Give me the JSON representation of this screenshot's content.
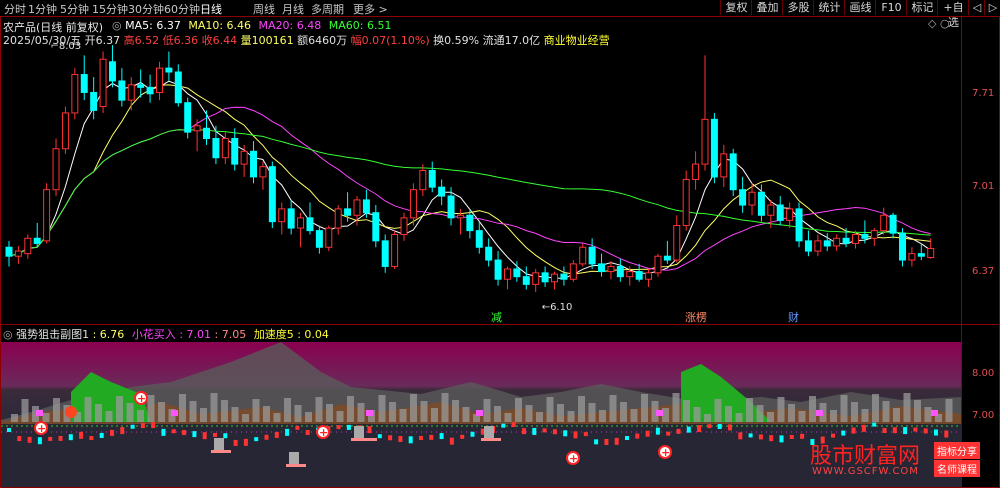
{
  "toolbar": {
    "timeframes": [
      "分时",
      "1分钟",
      "5分钟",
      "15分钟",
      "30分钟",
      "60分钟",
      "日线",
      "周线",
      "月线",
      "多周期",
      "更多 >"
    ],
    "active_timeframe": "日线",
    "right_buttons": [
      "复权",
      "叠加",
      "多股",
      "统计",
      "画线",
      "F10",
      "标记",
      "+自选",
      "◁",
      "▷"
    ]
  },
  "stock": {
    "title": "农产品(日线 前复权)",
    "date": "2025/05/30/五",
    "open_label": "开",
    "open": "6.37",
    "high_label": "高",
    "high": "6.52",
    "low_label": "低",
    "low": "6.36",
    "close_label": "收",
    "close": "6.44",
    "vol_label": "量",
    "volume": "100161",
    "amount_label": "额",
    "amount": "6460万",
    "chg_label": "幅",
    "change": "0.07(1.10%)",
    "turnover": "换0.59%",
    "float_cap": "流通17.0亿",
    "industry": "商业物业经营"
  },
  "ma_legend": [
    {
      "label": "MA5: 6.37",
      "color": "#ffffff"
    },
    {
      "label": "MA10: 6.46",
      "color": "#ffff66"
    },
    {
      "label": "MA20: 6.48",
      "color": "#ff44ff"
    },
    {
      "label": "MA60: 6.51",
      "color": "#33ff33"
    }
  ],
  "sub_indicator": {
    "name": "强势狙击副图1",
    "v1": ": 6.76",
    "v2_label": "小花买入",
    "v2": ": 7.01",
    "v3": ": 7.05",
    "v4_label": "加速度5",
    "v4": ": 0.04"
  },
  "watermark": {
    "brand": "股市财富网",
    "url": "WWW.GSCFW.COM",
    "tag1": "指标分享",
    "tag2": "名师课程"
  },
  "colors": {
    "up": "#ff3232",
    "down": "#00ffff",
    "ma5": "#ffffff",
    "ma10": "#ffff66",
    "ma20": "#ff44ff",
    "ma60": "#33ff33",
    "frame": "#8b0000"
  },
  "chart_data": {
    "type": "candlestick",
    "price_axis_labels": [
      "7.71",
      "7.01",
      "6.37"
    ],
    "sub_axis_labels": [
      "8.00",
      "7.00"
    ],
    "annotations": {
      "high_mark": "8.03",
      "low_mark": "6.10",
      "events": [
        "减",
        "涨楞",
        "财"
      ]
    },
    "ylim": [
      5.85,
      8.25
    ],
    "candles": [
      [
        6.45,
        6.5,
        6.3,
        6.38
      ],
      [
        6.38,
        6.46,
        6.32,
        6.42
      ],
      [
        6.4,
        6.55,
        6.36,
        6.52
      ],
      [
        6.52,
        6.64,
        6.45,
        6.48
      ],
      [
        6.5,
        6.95,
        6.48,
        6.9
      ],
      [
        6.9,
        7.3,
        6.85,
        7.22
      ],
      [
        7.22,
        7.55,
        7.18,
        7.5
      ],
      [
        7.5,
        7.85,
        7.45,
        7.8
      ],
      [
        7.8,
        7.95,
        7.6,
        7.66
      ],
      [
        7.66,
        7.78,
        7.45,
        7.52
      ],
      [
        7.55,
        7.98,
        7.5,
        7.92
      ],
      [
        7.9,
        8.03,
        7.7,
        7.75
      ],
      [
        7.75,
        7.85,
        7.55,
        7.6
      ],
      [
        7.6,
        7.78,
        7.52,
        7.72
      ],
      [
        7.72,
        7.84,
        7.62,
        7.7
      ],
      [
        7.7,
        7.8,
        7.58,
        7.65
      ],
      [
        7.66,
        7.9,
        7.6,
        7.85
      ],
      [
        7.85,
        7.98,
        7.75,
        7.82
      ],
      [
        7.82,
        7.88,
        7.55,
        7.58
      ],
      [
        7.58,
        7.62,
        7.3,
        7.35
      ],
      [
        7.36,
        7.45,
        7.2,
        7.4
      ],
      [
        7.38,
        7.52,
        7.25,
        7.3
      ],
      [
        7.3,
        7.4,
        7.1,
        7.15
      ],
      [
        7.15,
        7.35,
        7.1,
        7.3
      ],
      [
        7.3,
        7.38,
        7.05,
        7.1
      ],
      [
        7.1,
        7.25,
        7.0,
        7.2
      ],
      [
        7.2,
        7.28,
        6.95,
        7.0
      ],
      [
        7.0,
        7.12,
        6.9,
        7.08
      ],
      [
        7.08,
        7.12,
        6.6,
        6.65
      ],
      [
        6.65,
        6.8,
        6.55,
        6.75
      ],
      [
        6.75,
        6.82,
        6.55,
        6.6
      ],
      [
        6.6,
        6.72,
        6.45,
        6.68
      ],
      [
        6.68,
        6.8,
        6.55,
        6.58
      ],
      [
        6.58,
        6.62,
        6.4,
        6.45
      ],
      [
        6.45,
        6.62,
        6.42,
        6.6
      ],
      [
        6.6,
        6.78,
        6.55,
        6.75
      ],
      [
        6.75,
        6.88,
        6.65,
        6.7
      ],
      [
        6.7,
        6.85,
        6.62,
        6.82
      ],
      [
        6.82,
        6.9,
        6.68,
        6.72
      ],
      [
        6.72,
        6.78,
        6.45,
        6.5
      ],
      [
        6.5,
        6.55,
        6.25,
        6.3
      ],
      [
        6.3,
        6.58,
        6.28,
        6.55
      ],
      [
        6.55,
        6.72,
        6.5,
        6.68
      ],
      [
        6.68,
        6.95,
        6.62,
        6.9
      ],
      [
        6.9,
        7.1,
        6.85,
        7.05
      ],
      [
        7.05,
        7.12,
        6.88,
        6.92
      ],
      [
        6.92,
        6.98,
        6.78,
        6.85
      ],
      [
        6.85,
        6.92,
        6.62,
        6.68
      ],
      [
        6.68,
        6.75,
        6.55,
        6.7
      ],
      [
        6.7,
        6.74,
        6.52,
        6.58
      ],
      [
        6.58,
        6.65,
        6.4,
        6.45
      ],
      [
        6.45,
        6.52,
        6.3,
        6.35
      ],
      [
        6.35,
        6.42,
        6.15,
        6.2
      ],
      [
        6.2,
        6.3,
        6.12,
        6.28
      ],
      [
        6.28,
        6.34,
        6.18,
        6.22
      ],
      [
        6.22,
        6.3,
        6.12,
        6.16
      ],
      [
        6.16,
        6.28,
        6.1,
        6.25
      ],
      [
        6.25,
        6.3,
        6.14,
        6.18
      ],
      [
        6.18,
        6.26,
        6.12,
        6.24
      ],
      [
        6.24,
        6.3,
        6.15,
        6.2
      ],
      [
        6.2,
        6.35,
        6.18,
        6.32
      ],
      [
        6.32,
        6.48,
        6.3,
        6.45
      ],
      [
        6.45,
        6.52,
        6.28,
        6.32
      ],
      [
        6.32,
        6.4,
        6.22,
        6.26
      ],
      [
        6.26,
        6.34,
        6.2,
        6.3
      ],
      [
        6.3,
        6.36,
        6.18,
        6.22
      ],
      [
        6.22,
        6.3,
        6.15,
        6.26
      ],
      [
        6.26,
        6.32,
        6.18,
        6.2
      ],
      [
        6.2,
        6.28,
        6.14,
        6.25
      ],
      [
        6.25,
        6.4,
        6.22,
        6.38
      ],
      [
        6.38,
        6.5,
        6.32,
        6.35
      ],
      [
        6.35,
        6.7,
        6.33,
        6.62
      ],
      [
        6.62,
        7.05,
        6.58,
        6.98
      ],
      [
        6.98,
        7.2,
        6.9,
        7.1
      ],
      [
        7.1,
        7.95,
        7.05,
        7.45
      ],
      [
        7.45,
        7.5,
        6.95,
        7.0
      ],
      [
        7.0,
        7.25,
        6.92,
        7.18
      ],
      [
        7.18,
        7.22,
        6.85,
        6.9
      ],
      [
        6.9,
        7.0,
        6.72,
        6.78
      ],
      [
        6.78,
        6.95,
        6.7,
        6.88
      ],
      [
        6.88,
        6.94,
        6.65,
        6.7
      ],
      [
        6.7,
        6.82,
        6.6,
        6.78
      ],
      [
        6.78,
        6.85,
        6.62,
        6.66
      ],
      [
        6.66,
        6.8,
        6.6,
        6.75
      ],
      [
        6.75,
        6.8,
        6.45,
        6.5
      ],
      [
        6.5,
        6.58,
        6.38,
        6.42
      ],
      [
        6.42,
        6.55,
        6.38,
        6.5
      ],
      [
        6.5,
        6.56,
        6.42,
        6.46
      ],
      [
        6.46,
        6.55,
        6.42,
        6.52
      ],
      [
        6.52,
        6.6,
        6.45,
        6.48
      ],
      [
        6.48,
        6.58,
        6.44,
        6.55
      ],
      [
        6.55,
        6.66,
        6.48,
        6.52
      ],
      [
        6.52,
        6.6,
        6.46,
        6.58
      ],
      [
        6.58,
        6.76,
        6.55,
        6.7
      ],
      [
        6.7,
        6.72,
        6.52,
        6.56
      ],
      [
        6.56,
        6.6,
        6.3,
        6.35
      ],
      [
        6.35,
        6.45,
        6.3,
        6.4
      ],
      [
        6.4,
        6.48,
        6.35,
        6.38
      ],
      [
        6.37,
        6.52,
        6.36,
        6.44
      ]
    ]
  }
}
